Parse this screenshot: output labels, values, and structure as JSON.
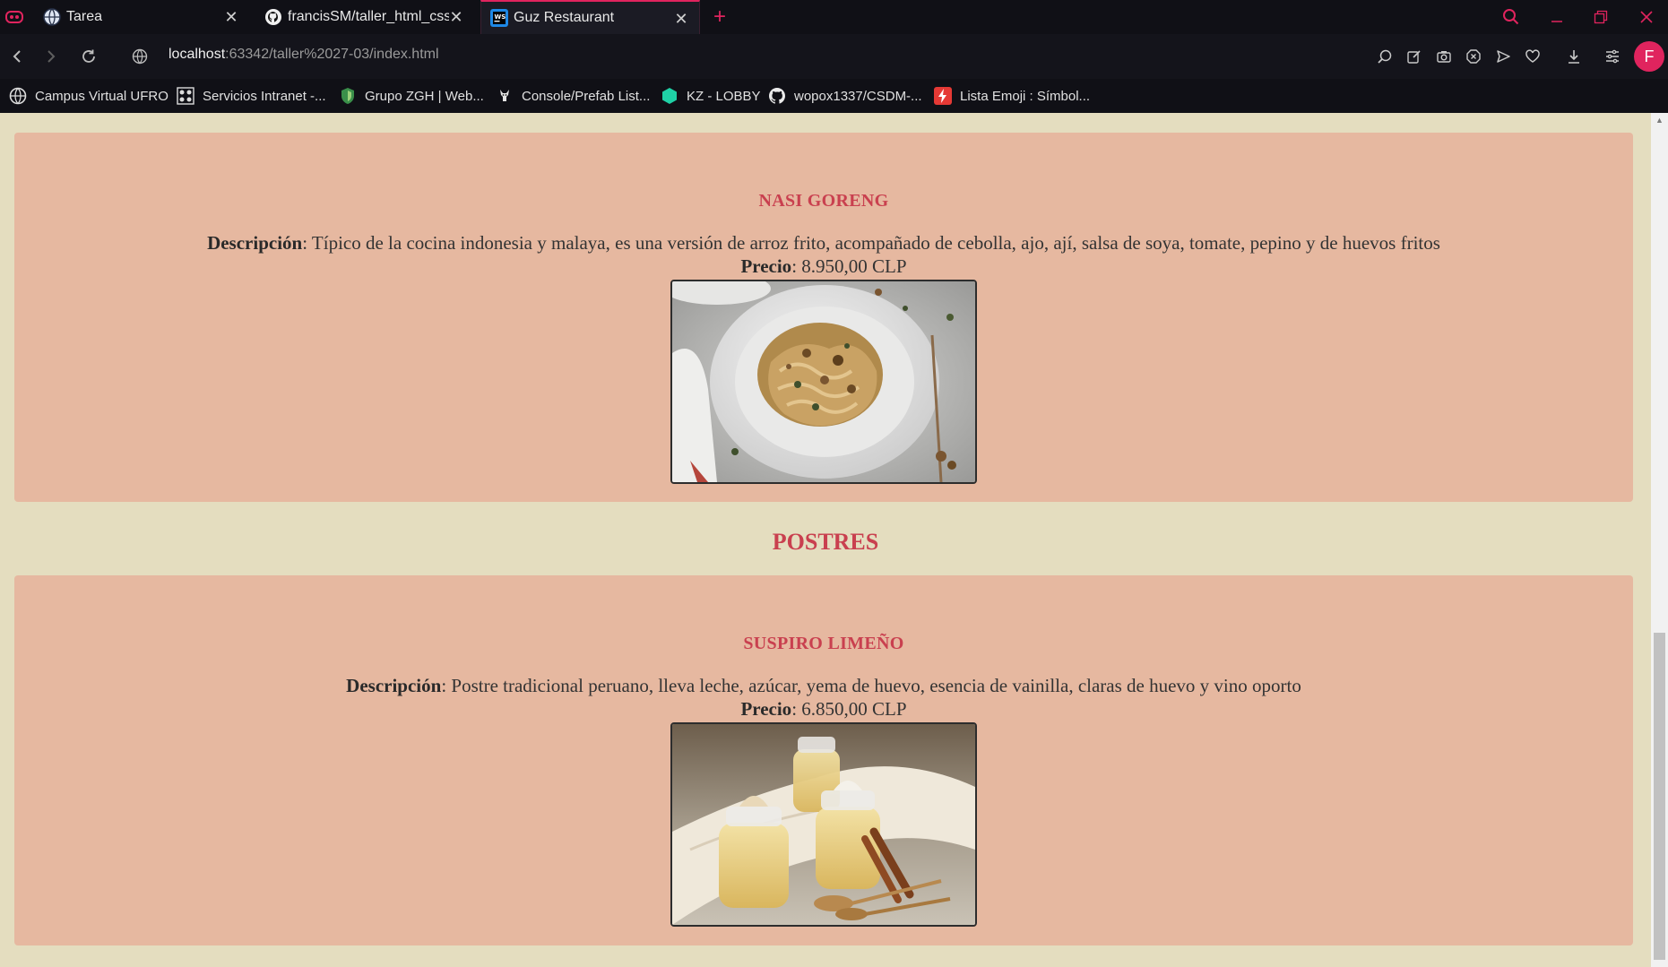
{
  "browser": {
    "tabs": [
      {
        "title": "Tarea",
        "icon": "moodle-globe-icon"
      },
      {
        "title": "francisSM/taller_html_css: T",
        "icon": "github-icon"
      },
      {
        "title": "Guz Restaurant",
        "icon": "webstorm-icon"
      }
    ],
    "url": {
      "host": "localhost",
      "path": ":63342/taller%2027-03/index.html"
    },
    "profile_initial": "F",
    "bookmarks": [
      {
        "label": "Campus Virtual UFRO",
        "icon": "globe-icon"
      },
      {
        "label": "Servicios Intranet -...",
        "icon": "grid-icon"
      },
      {
        "label": "Grupo ZGH | Web...",
        "icon": "shield-icon"
      },
      {
        "label": "Console/Prefab List...",
        "icon": "goat-icon"
      },
      {
        "label": "KZ - LOBBY",
        "icon": "hexagon-icon"
      },
      {
        "label": "wopox1337/CSDM-...",
        "icon": "github-icon"
      },
      {
        "label": "Lista Emoji : Símbol...",
        "icon": "bolt-icon"
      }
    ],
    "accent_color": "#e0245e"
  },
  "page": {
    "dish1": {
      "name": "NASI GORENG",
      "desc_label": "Descripción",
      "desc_text": ": Típico de la cocina indonesia y malaya, es una versión de arroz frito, acompañado de cebolla, ajo, ají, salsa de soya, tomate, pepino y de huevos fritos",
      "price_label": "Precio",
      "price_text": ": 8.950,00 CLP"
    },
    "section_postres": "POSTRES",
    "dish2": {
      "name": "SUSPIRO LIMEÑO",
      "desc_label": "Descripción",
      "desc_text": ": Postre tradicional peruano, lleva leche, azúcar, yema de huevo, esencia de vainilla, claras de huevo y vino oporto",
      "price_label": "Precio",
      "price_text": ": 6.850,00 CLP"
    },
    "colors": {
      "background": "#e4ddbf",
      "card": "#e6b8a0",
      "heading": "#c9404f"
    }
  }
}
